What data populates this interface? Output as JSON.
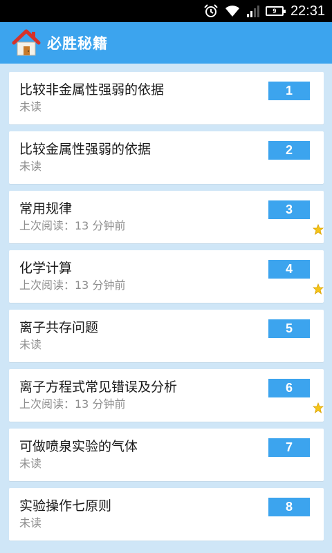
{
  "status_bar": {
    "time": "22:31",
    "battery_level": "9",
    "icons": [
      "alarm-icon",
      "wifi-icon",
      "signal-icon",
      "battery-icon"
    ]
  },
  "header": {
    "title": "必胜秘籍",
    "icon": "home-icon"
  },
  "colors": {
    "accent": "#3ca4ee",
    "background": "#cfe6f7",
    "star": "#f5c518"
  },
  "items": [
    {
      "title": "比较非金属性强弱的依据",
      "status": "未读",
      "number": "1",
      "starred": false
    },
    {
      "title": "比较金属性强弱的依据",
      "status": "未读",
      "number": "2",
      "starred": false
    },
    {
      "title": "常用规律",
      "status": "上次阅读：13 分钟前",
      "number": "3",
      "starred": true
    },
    {
      "title": "化学计算",
      "status": "上次阅读：13 分钟前",
      "number": "4",
      "starred": true
    },
    {
      "title": "离子共存问题",
      "status": "未读",
      "number": "5",
      "starred": false
    },
    {
      "title": "离子方程式常见错误及分析",
      "status": "上次阅读：13 分钟前",
      "number": "6",
      "starred": true
    },
    {
      "title": "可做喷泉实验的气体",
      "status": "未读",
      "number": "7",
      "starred": false
    },
    {
      "title": "实验操作七原则",
      "status": "未读",
      "number": "8",
      "starred": false
    }
  ]
}
